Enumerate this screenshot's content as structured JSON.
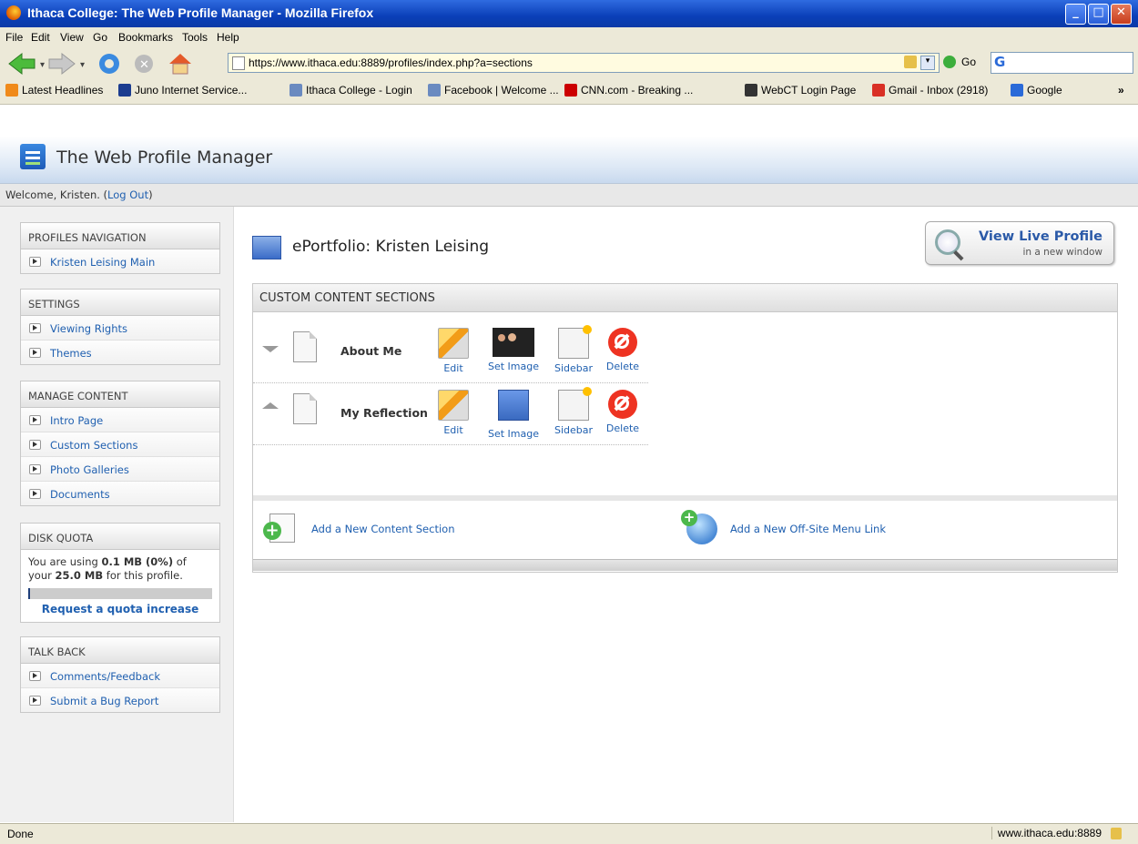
{
  "window": {
    "title": "Ithaca College: The Web Profile Manager - Mozilla Firefox"
  },
  "menu": [
    "File",
    "Edit",
    "View",
    "Go",
    "Bookmarks",
    "Tools",
    "Help"
  ],
  "toolbar": {
    "url": "https://www.ithaca.edu:8889/profiles/index.php?a=sections",
    "go_label": "Go"
  },
  "bookmarks": [
    {
      "label": "Latest Headlines",
      "icon": "rss-icon",
      "color": "#f08a1a"
    },
    {
      "label": "Juno Internet Service...",
      "icon": "juno-icon",
      "color": "#1b3c8f"
    },
    {
      "label": "Ithaca College - Login",
      "icon": "ithaca-icon",
      "color": "#6a8ac0"
    },
    {
      "label": "Facebook | Welcome ...",
      "icon": "facebook-icon",
      "color": "#6a8ac0"
    },
    {
      "label": "CNN.com - Breaking ...",
      "icon": "cnn-icon",
      "color": "#cc0000"
    },
    {
      "label": "WebCT Login Page",
      "icon": "webct-icon",
      "color": "#333333"
    },
    {
      "label": "Gmail - Inbox (2918)",
      "icon": "gmail-icon",
      "color": "#d93025"
    },
    {
      "label": "Google",
      "icon": "google-icon",
      "color": "#2a6ad8"
    }
  ],
  "app": {
    "title": "The Web Profile Manager"
  },
  "welcome": {
    "text": "Welcome, Kristen. (",
    "logout": "Log Out",
    "close": ")"
  },
  "sidebar": {
    "nav": {
      "heading": "PROFILES NAVIGATION",
      "items": [
        "Kristen Leising Main"
      ]
    },
    "settings": {
      "heading": "SETTINGS",
      "items": [
        "Viewing Rights",
        "Themes"
      ]
    },
    "content": {
      "heading": "MANAGE CONTENT",
      "items": [
        "Intro Page",
        "Custom Sections",
        "Photo Galleries",
        "Documents"
      ]
    },
    "quota": {
      "heading": "DISK QUOTA",
      "prefix": "You are using ",
      "used": "0.1 MB (0%)",
      "mid": " of your ",
      "total": "25.0 MB",
      "suffix": " for this profile.",
      "request": "Request a quota increase",
      "fraction": 0.0
    },
    "talk": {
      "heading": "TALK BACK",
      "items": [
        "Comments/Feedback",
        "Submit a Bug Report"
      ]
    }
  },
  "main": {
    "title": "ePortfolio: Kristen Leising",
    "view_live": {
      "line1": "View Live Profile",
      "line2": "in a new window"
    },
    "sections_heading": "CUSTOM CONTENT SECTIONS",
    "rows": [
      {
        "name": "About Me"
      },
      {
        "name": "My Reflection"
      }
    ],
    "actions": {
      "edit": "Edit",
      "set_image": "Set Image",
      "sidebar": "Sidebar",
      "delete": "Delete"
    },
    "add_section": "Add a New Content Section",
    "add_link": "Add a New Off-Site Menu Link"
  },
  "status": {
    "left": "Done",
    "right": "www.ithaca.edu:8889"
  }
}
